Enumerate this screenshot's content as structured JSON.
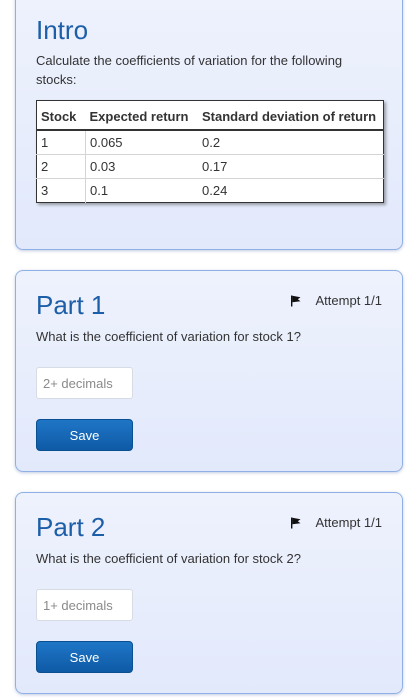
{
  "intro": {
    "title": "Intro",
    "description": "Calculate the coefficients of variation for the following stocks:",
    "table": {
      "headers": [
        "Stock",
        "Expected return",
        "Standard deviation of return"
      ],
      "rows": [
        [
          "1",
          "0.065",
          "0.2"
        ],
        [
          "2",
          "0.03",
          "0.17"
        ],
        [
          "3",
          "0.1",
          "0.24"
        ]
      ]
    }
  },
  "parts": [
    {
      "title": "Part 1",
      "attempt": "Attempt 1/1",
      "question": "What is the coefficient of variation for stock 1?",
      "input_value": "",
      "input_placeholder": "2+ decimals",
      "save_label": "Save",
      "flag_icon": "flag-icon"
    },
    {
      "title": "Part 2",
      "attempt": "Attempt 1/1",
      "question": "What is the coefficient of variation for stock 2?",
      "input_value": "",
      "input_placeholder": "1+ decimals",
      "save_label": "Save",
      "flag_icon": "flag-icon"
    }
  ],
  "colors": {
    "title_blue": "#1c5ea8",
    "card_border": "#8fb0e6",
    "button_blue": "#0e5aa6"
  }
}
